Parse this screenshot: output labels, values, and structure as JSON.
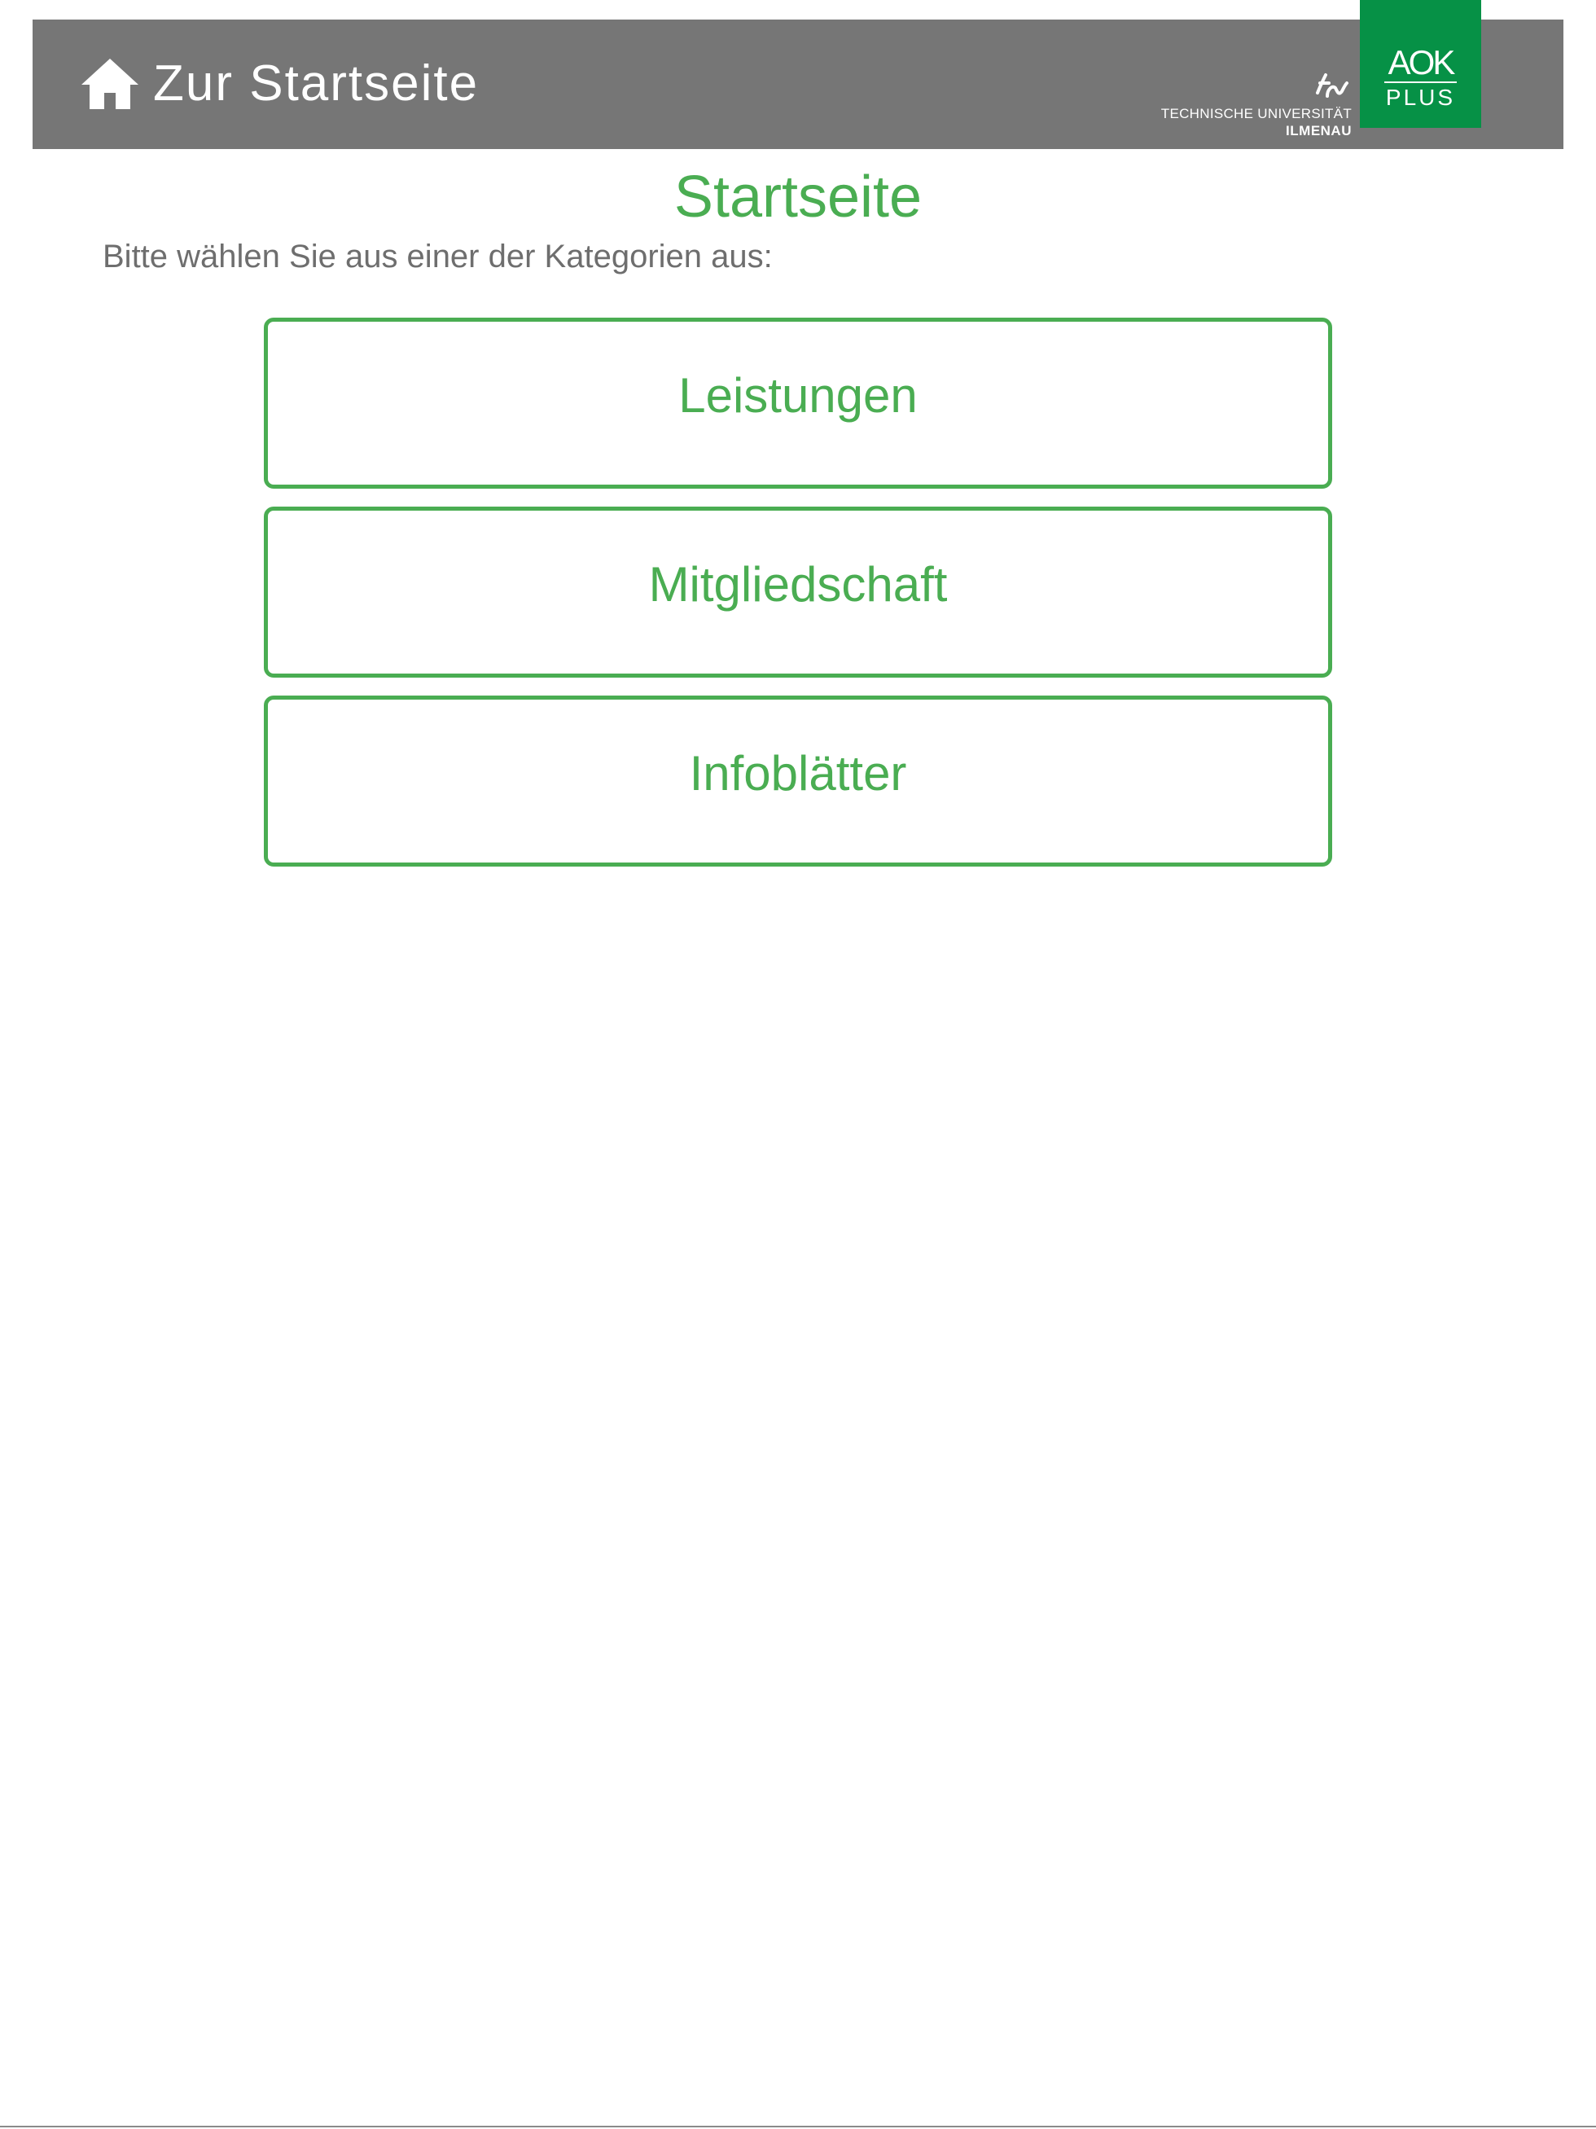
{
  "header": {
    "home_label": "Zur Startseite",
    "home_icon": "house-icon",
    "background_color": "#767676"
  },
  "logos": {
    "tu": {
      "line1": "TECHNISCHE UNIVERSITÄT",
      "line2": "ILMENAU"
    },
    "aok": {
      "top": "AOK",
      "bottom": "PLUS",
      "color": "#069146"
    }
  },
  "main": {
    "title": "Startseite",
    "instruction": "Bitte wählen Sie aus einer der Kategorien aus:",
    "categories": [
      {
        "label": "Leistungen"
      },
      {
        "label": "Mitgliedschaft"
      },
      {
        "label": "Infoblätter"
      }
    ]
  },
  "colors": {
    "accent": "#4aad52",
    "text_secondary": "#6e6e6e"
  }
}
